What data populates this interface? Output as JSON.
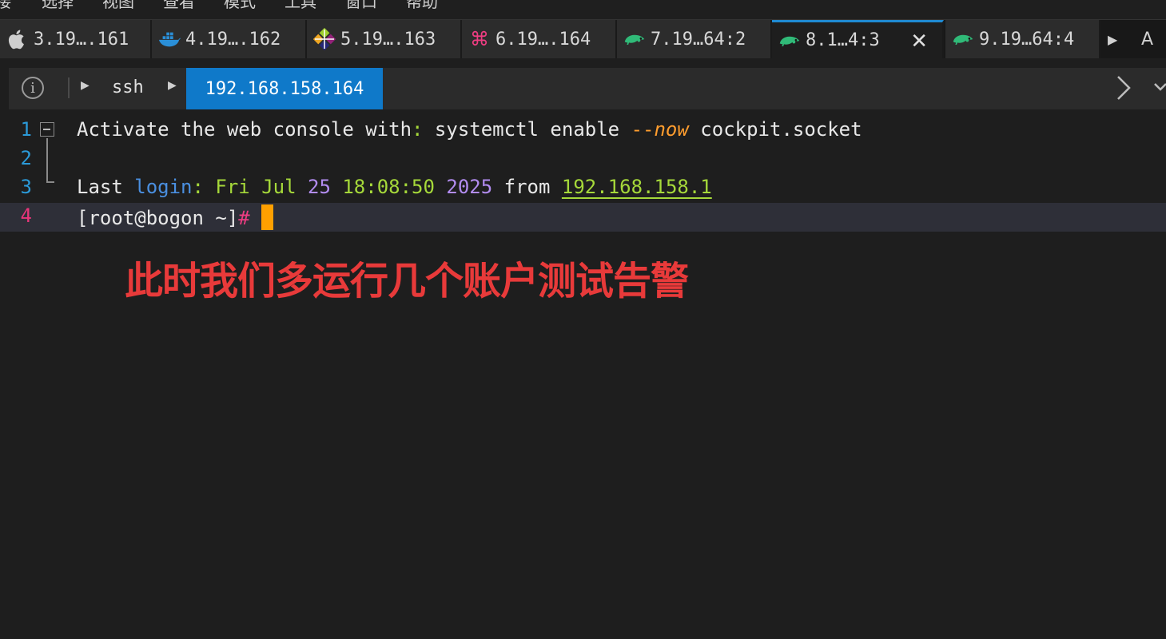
{
  "menu": {
    "items": [
      "接",
      "选择",
      "视图",
      "查看",
      "模式",
      "工具",
      "窗口",
      "帮助"
    ]
  },
  "tabs": [
    {
      "label": "3.19….161",
      "icon": "apple-icon"
    },
    {
      "label": "4.19….162",
      "icon": "docker-icon"
    },
    {
      "label": "5.19….163",
      "icon": "centos-icon"
    },
    {
      "label": "6.19….164",
      "icon": "command-icon"
    },
    {
      "label": "7.19…64:2",
      "icon": "suse-chameleon-icon"
    },
    {
      "label": "8.1…4:3",
      "icon": "suse-chameleon-icon",
      "active": true
    },
    {
      "label": "9.19…64:4",
      "icon": "suse-chameleon-icon"
    }
  ],
  "tab_overflow": {
    "label": "A"
  },
  "path": {
    "segments": [
      "ssh"
    ],
    "current": "192.168.158.164"
  },
  "terminal": {
    "line_numbers": [
      "1",
      "2",
      "3",
      "4"
    ],
    "line1": {
      "prefix": "Activate the web console with",
      "colon": ":",
      "cmd": " systemctl enable ",
      "flag_dash": "--",
      "flag": "now",
      "arg": " cockpit.socket"
    },
    "line3": {
      "w1": "Last ",
      "w2": "login",
      "colon": ":",
      "day": " Fri Jul ",
      "date": "25",
      "time": " 18:08:50 ",
      "year": "2025",
      "from": " from ",
      "ip": "192.168.158.1"
    },
    "line4": {
      "prompt": "[root@bogon ~]",
      "hash": "#",
      "space": " "
    }
  },
  "annotation": "此时我们多运行几个账户测试告警",
  "colors": {
    "accent": "#0f79c9",
    "cursor": "#ffa000",
    "annotation": "#e83a3a"
  }
}
